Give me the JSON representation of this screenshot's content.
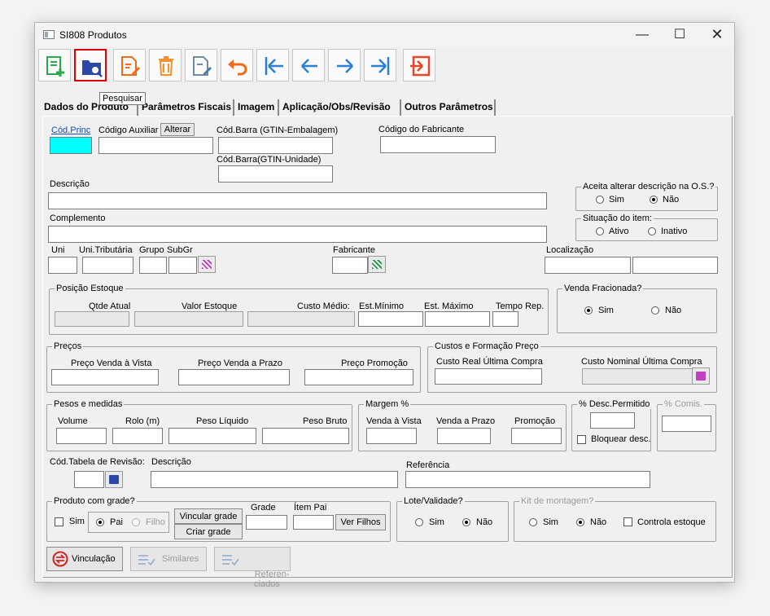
{
  "window": {
    "title": "SI808 Produtos"
  },
  "tooltip": "Pesquisar",
  "tabs": [
    "Dados do Produto",
    "Parâmetros Fiscais",
    "Imagem",
    "Aplicação/Obs/Revisão",
    "Outros Parâmetros"
  ],
  "top_fields": {
    "cod_princ": "Cód.Princ",
    "cod_auxiliar": "Código Auxiliar",
    "alterar": "Alterar",
    "cod_barra_emb": "Cód.Barra (GTIN-Embalagem)",
    "cod_barra_uni": "Cód.Barra(GTIN-Unidade)",
    "cod_fabricante": "Código do Fabricante",
    "descricao": "Descrição",
    "complemento": "Complemento",
    "uni": "Uni",
    "uni_tributaria": "Uni.Tributária",
    "grupo": "Grupo",
    "subgr": "SubGr",
    "fabricante": "Fabricante",
    "localizacao": "Localização"
  },
  "aceita_desc": {
    "title": "Aceita alterar descrição na O.S.?",
    "sim": "Sim",
    "nao": "Não",
    "selected": "Não"
  },
  "situacao": {
    "title": "Situação do item:",
    "ativo": "Ativo",
    "inativo": "Inativo"
  },
  "posicao_estoque": {
    "title": "Posição Estoque",
    "qtde": "Qtde Atual",
    "valor": "Valor Estoque",
    "custo": "Custo Médio:",
    "min": "Est.Mínimo",
    "max": "Est. Máximo",
    "tempo": "Tempo Rep."
  },
  "venda_fracionada": {
    "title": "Venda Fracionada?",
    "sim": "Sim",
    "nao": "Não",
    "selected": "Sim"
  },
  "precos": {
    "title": "Preços",
    "vista": "Preço Venda à Vista",
    "prazo": "Preço Venda a Prazo",
    "promo": "Preço Promoção"
  },
  "custos": {
    "title": "Custos e Formação Preço",
    "real": "Custo Real Última Compra",
    "nominal": "Custo Nominal Última Compra"
  },
  "pesos": {
    "title": "Pesos e medidas",
    "volume": "Volume",
    "rolo": "Rolo (m)",
    "liquido": "Peso Líquido",
    "bruto": "Peso Bruto"
  },
  "margem": {
    "title": "Margem %",
    "vista": "Venda à Vista",
    "prazo": "Venda a Prazo",
    "promo": "Promoção"
  },
  "desc_permitido": {
    "title": "% Desc.Permitido",
    "bloquear": "Bloquear desc."
  },
  "comis": {
    "title": "% Comis."
  },
  "revisao": {
    "cod_tabela": "Cód.Tabela de Revisão:",
    "descricao": "Descrição",
    "referencia": "Referência"
  },
  "grade": {
    "title": "Produto com grade?",
    "sim": "Sim",
    "pai": "Pai",
    "filho": "Filho",
    "vincular": "Vincular grade",
    "criar": "Criar grade",
    "grade": "Grade",
    "item_pai": "Ítem Pai",
    "ver_filhos": "Ver Filhos"
  },
  "lote": {
    "title": "Lote/Validade?",
    "sim": "Sim",
    "nao": "Não",
    "selected": "Não"
  },
  "kit": {
    "title": "Kit de montagem?",
    "sim": "Sim",
    "nao": "Não",
    "controla": "Controla estoque",
    "selected": "Não"
  },
  "bottom_buttons": {
    "vinculacao": "Vinculação",
    "similares": "Similares",
    "referenciados": "Referen-\nciados"
  }
}
